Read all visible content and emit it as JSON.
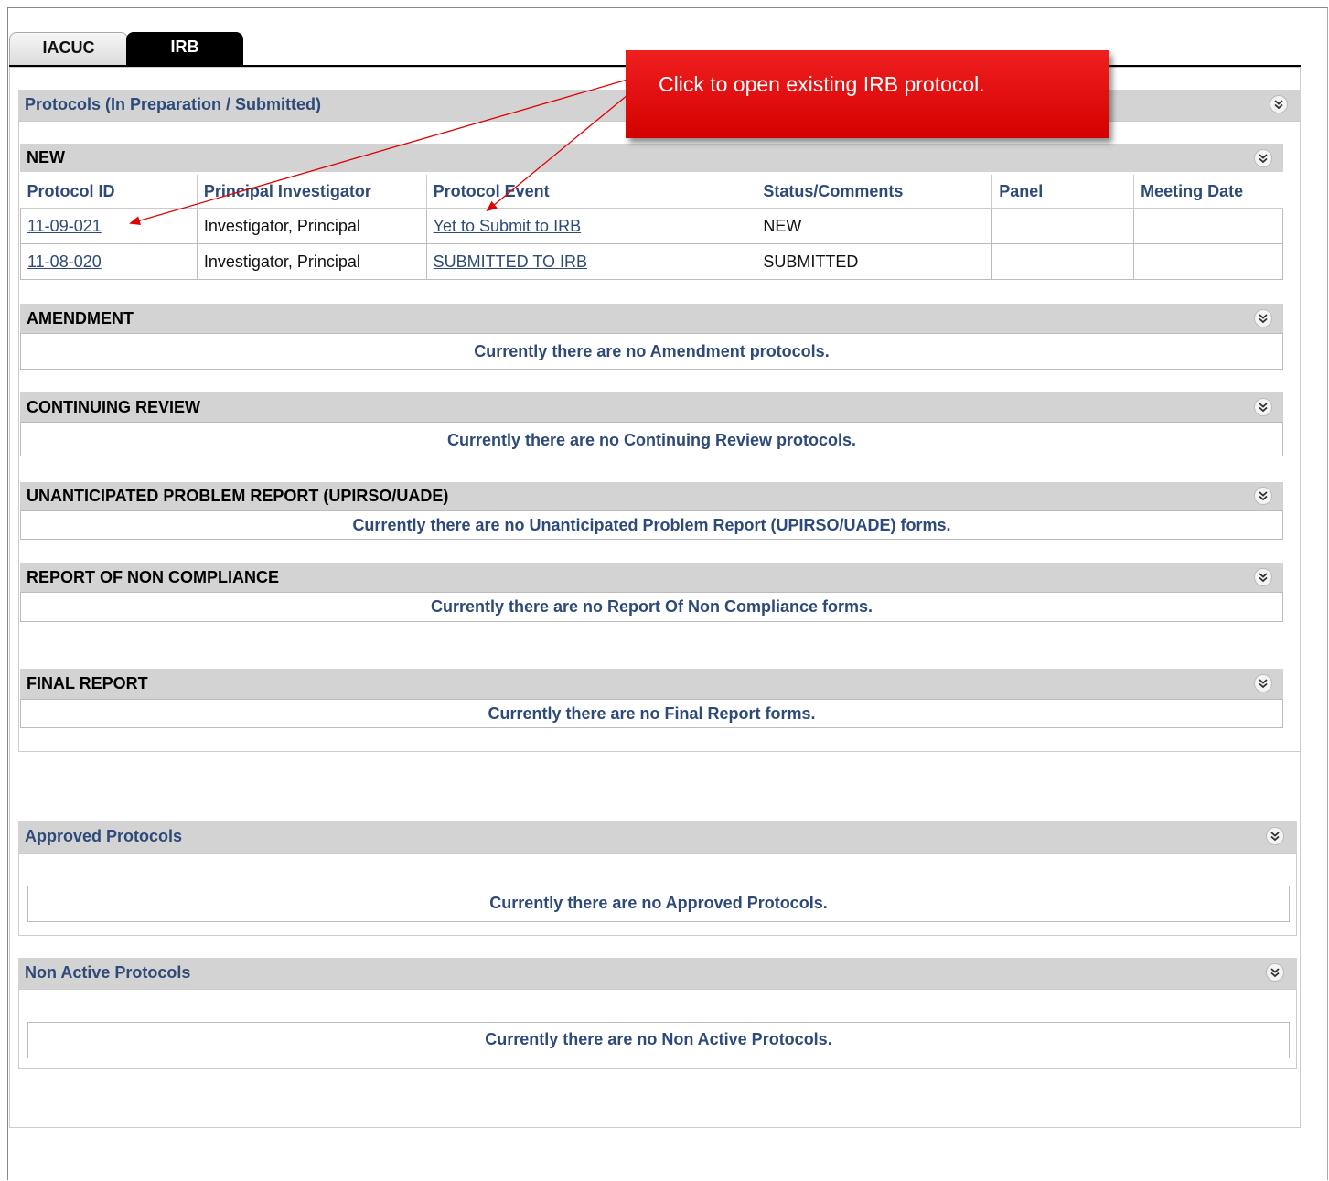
{
  "tabs": [
    {
      "label": "IACUC"
    },
    {
      "label": "IRB"
    }
  ],
  "in_prep": {
    "title": "Protocols (In Preparation / Submitted)",
    "new": {
      "title": "NEW",
      "columns": [
        "Protocol ID",
        "Principal Investigator",
        "Protocol Event",
        "Status/Comments",
        "Panel",
        "Meeting Date"
      ],
      "rows": [
        {
          "id": "11-09-021",
          "pi": "Investigator, Principal",
          "event": "Yet to Submit to IRB",
          "status": "NEW",
          "panel": "",
          "meeting": ""
        },
        {
          "id": "11-08-020",
          "pi": "Investigator, Principal",
          "event": "SUBMITTED TO IRB",
          "status": "SUBMITTED",
          "panel": "",
          "meeting": ""
        }
      ]
    },
    "amendment": {
      "title": "AMENDMENT",
      "empty": "Currently there are no Amendment protocols."
    },
    "continuing": {
      "title": "CONTINUING REVIEW",
      "empty": "Currently there are no Continuing Review protocols."
    },
    "unanticipated": {
      "title": "UNANTICIPATED PROBLEM REPORT (UPIRSO/UADE)",
      "empty": "Currently there are no Unanticipated Problem Report (UPIRSO/UADE) forms."
    },
    "noncompliance": {
      "title": "REPORT OF NON COMPLIANCE",
      "empty": "Currently there are no Report Of Non Compliance forms."
    },
    "final": {
      "title": "FINAL REPORT",
      "empty": "Currently there are no Final Report forms."
    }
  },
  "approved": {
    "title": "Approved Protocols",
    "empty": "Currently there are no Approved Protocols."
  },
  "nonactive": {
    "title": "Non Active Protocols",
    "empty": "Currently there are no Non Active Protocols."
  },
  "callout": {
    "text": "Click to open existing IRB protocol."
  },
  "colors": {
    "header_blue": "#2d4a78",
    "bar_gray": "#d3d3d3",
    "callout_red": "#e00000"
  }
}
